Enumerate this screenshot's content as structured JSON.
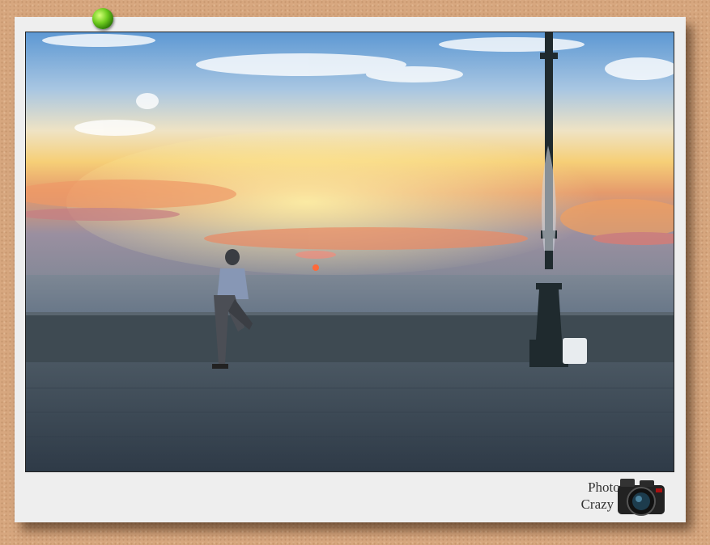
{
  "credit": {
    "line1": "Photo by",
    "line2": "Crazy SM"
  },
  "icons": {
    "pin": "green-pushpin-icon",
    "camera": "camera-icon"
  },
  "colors": {
    "background": "#d7a77f",
    "frame": "#eeeeee",
    "sky_top": "#6fa8d8",
    "sunset_glow": "#f7c86a",
    "sea": "#5b6f82",
    "road": "#3d4a56"
  }
}
